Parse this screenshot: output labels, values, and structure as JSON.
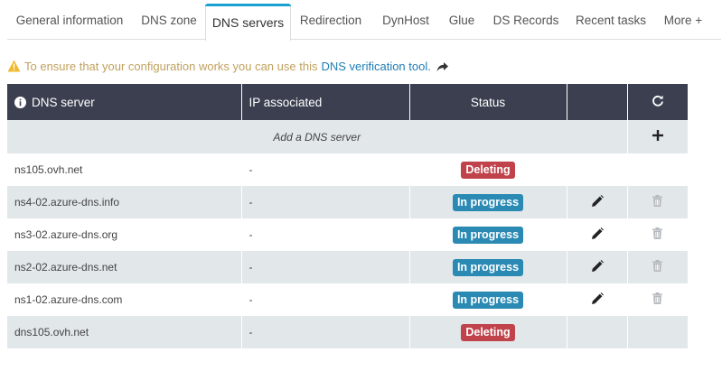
{
  "tabs": [
    {
      "label": "General information"
    },
    {
      "label": "DNS zone"
    },
    {
      "label": "DNS servers",
      "active": true
    },
    {
      "label": "Redirection"
    },
    {
      "label": "DynHost"
    },
    {
      "label": "Glue"
    },
    {
      "label": "DS Records"
    },
    {
      "label": "Recent tasks"
    },
    {
      "label": "More +"
    }
  ],
  "notice": {
    "icon": "warning-icon",
    "text": "To ensure that your configuration works you can use this",
    "link": "DNS verification tool.",
    "link_icon": "share-arrow-icon"
  },
  "table": {
    "headers": {
      "dns_server": "DNS server",
      "ip_associated": "IP associated",
      "status": "Status",
      "refresh_icon": "refresh-icon"
    },
    "add_row": {
      "label": "Add a DNS server",
      "icon": "plus-icon"
    },
    "rows": [
      {
        "server": "ns105.ovh.net",
        "ip": "-",
        "status": "Deleting",
        "status_type": "deleting",
        "editable": false,
        "deletable": false
      },
      {
        "server": "ns4-02.azure-dns.info",
        "ip": "-",
        "status": "In progress",
        "status_type": "progress",
        "editable": true,
        "deletable": true
      },
      {
        "server": "ns3-02.azure-dns.org",
        "ip": "-",
        "status": "In progress",
        "status_type": "progress",
        "editable": true,
        "deletable": true
      },
      {
        "server": "ns2-02.azure-dns.net",
        "ip": "-",
        "status": "In progress",
        "status_type": "progress",
        "editable": true,
        "deletable": true
      },
      {
        "server": "ns1-02.azure-dns.com",
        "ip": "-",
        "status": "In progress",
        "status_type": "progress",
        "editable": true,
        "deletable": true
      },
      {
        "server": "dns105.ovh.net",
        "ip": "-",
        "status": "Deleting",
        "status_type": "deleting",
        "editable": false,
        "deletable": false
      }
    ]
  },
  "colors": {
    "accent": "#1ba1cf",
    "header_bg": "#3b3f50",
    "row_shade": "#e2e7ea",
    "deleting": "#c0424b",
    "in_progress": "#2b8ab3",
    "warning": "#c0a15e",
    "link": "#1f7db4"
  }
}
